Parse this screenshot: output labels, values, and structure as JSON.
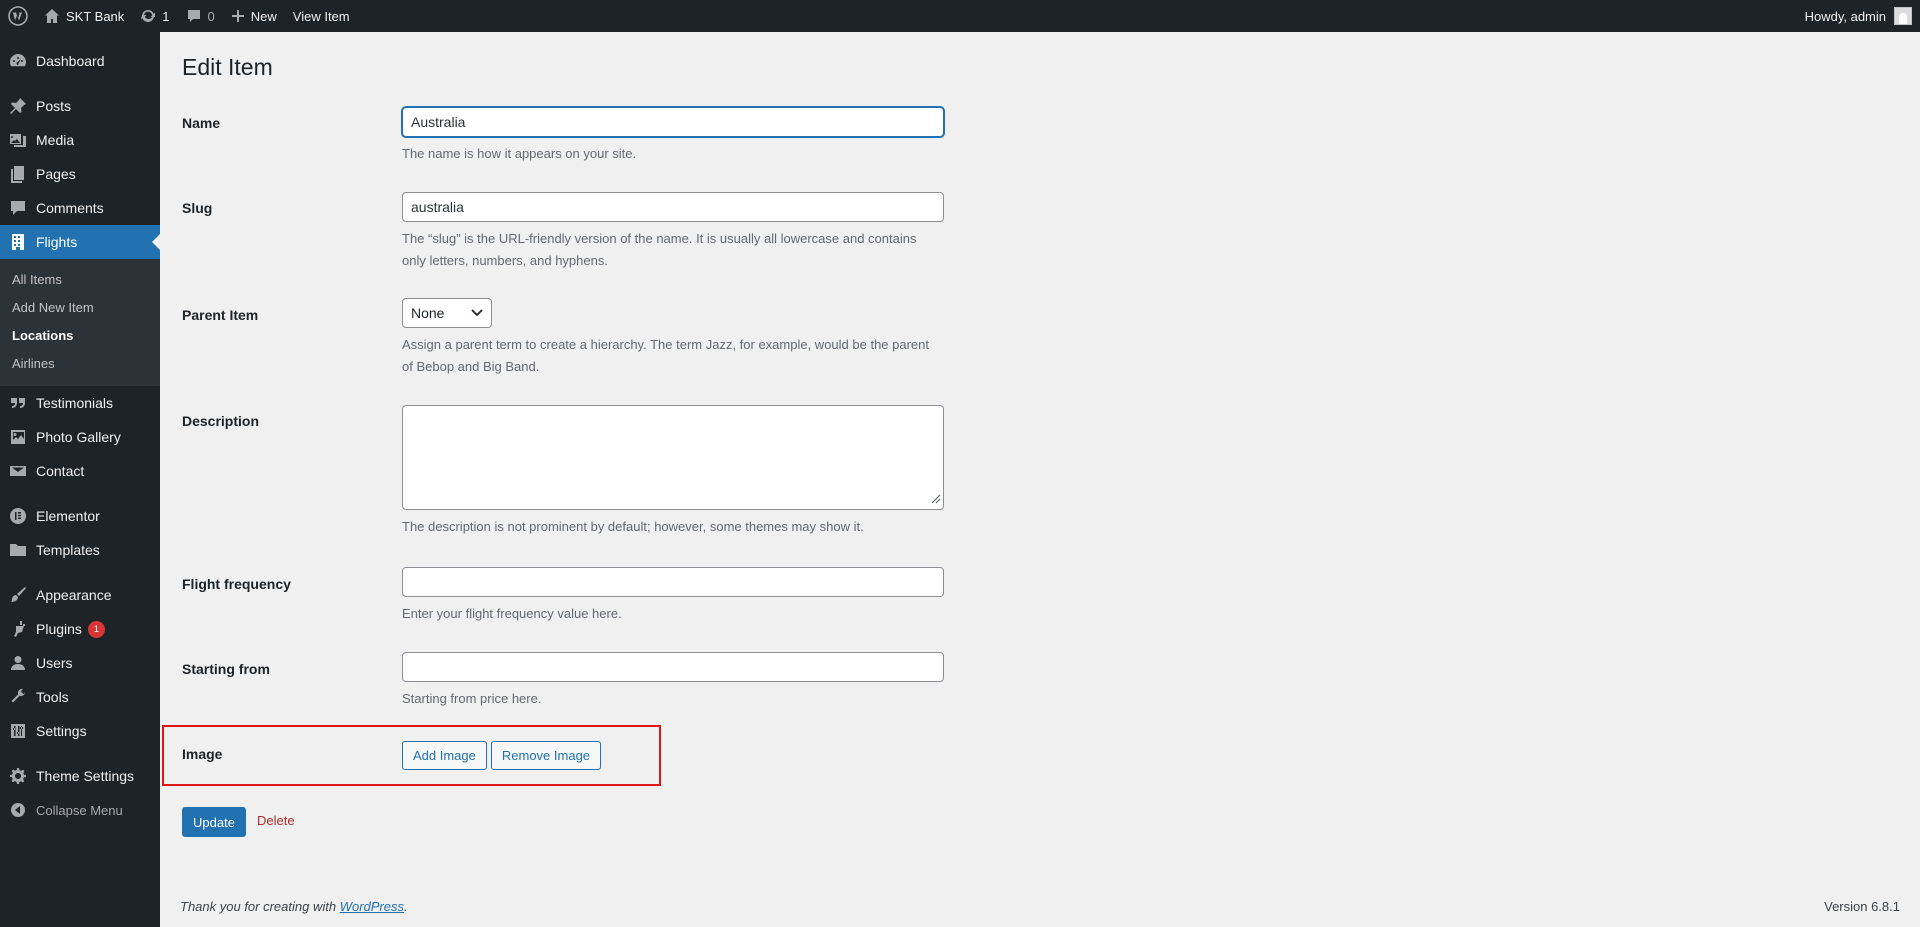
{
  "admin_bar": {
    "site_name": "SKT Bank",
    "updates_count": "1",
    "comments_count": "0",
    "new_label": "New",
    "view_label": "View Item",
    "greeting": "Howdy, admin"
  },
  "sidebar": {
    "dashboard": "Dashboard",
    "posts": "Posts",
    "media": "Media",
    "pages": "Pages",
    "comments": "Comments",
    "flights": "Flights",
    "flights_submenu": [
      "All Items",
      "Add New Item",
      "Locations",
      "Airlines"
    ],
    "testimonials": "Testimonials",
    "photo_gallery": "Photo Gallery",
    "contact": "Contact",
    "elementor": "Elementor",
    "templates": "Templates",
    "appearance": "Appearance",
    "plugins": "Plugins",
    "plugins_badge": "1",
    "users": "Users",
    "tools": "Tools",
    "settings": "Settings",
    "theme_settings": "Theme Settings",
    "collapse": "Collapse Menu"
  },
  "form": {
    "title": "Edit Item",
    "name_label": "Name",
    "name_value": "Australia",
    "name_desc": "The name is how it appears on your site.",
    "slug_label": "Slug",
    "slug_value": "australia",
    "slug_desc": "The “slug” is the URL-friendly version of the name. It is usually all lowercase and contains only letters, numbers, and hyphens.",
    "parent_label": "Parent Item",
    "parent_value": "None",
    "parent_desc": "Assign a parent term to create a hierarchy. The term Jazz, for example, would be the parent of Bebop and Big Band.",
    "description_label": "Description",
    "description_desc": "The description is not prominent by default; however, some themes may show it.",
    "frequency_label": "Flight frequency",
    "frequency_desc": "Enter your flight frequency value here.",
    "starting_label": "Starting from",
    "starting_desc": "Starting from price here.",
    "image_label": "Image",
    "add_image": "Add Image",
    "remove_image": "Remove Image",
    "update": "Update",
    "delete": "Delete"
  },
  "footer": {
    "thanks_prefix": "Thank you for creating with ",
    "thanks_link": "WordPress",
    "thanks_suffix": ".",
    "version": "Version 6.8.1"
  },
  "colors": {
    "accent": "#2271b1",
    "highlight_box": "#e01515",
    "admin_bg": "#1d2327"
  }
}
